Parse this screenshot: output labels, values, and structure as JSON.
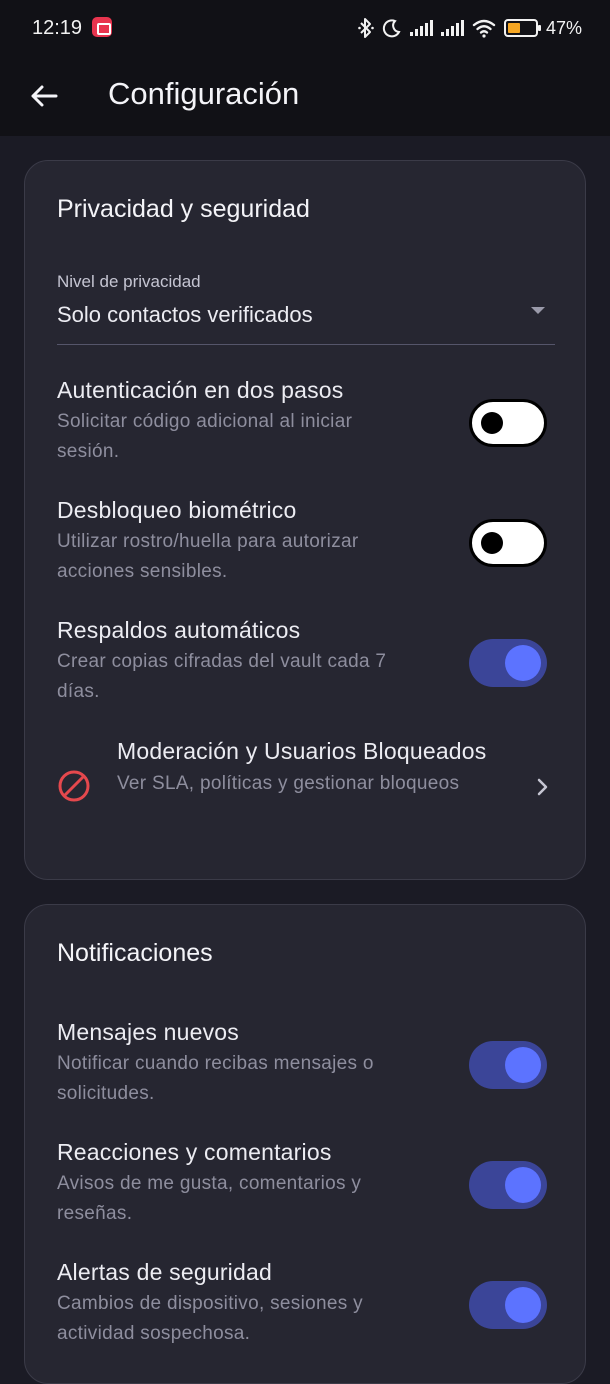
{
  "status_bar": {
    "time": "12:19",
    "battery_text": "47%",
    "battery_level": 0.47,
    "icons": [
      "bluetooth-icon",
      "moon-icon",
      "signal-icon",
      "signal-icon",
      "wifi-icon",
      "battery-icon"
    ]
  },
  "header": {
    "title": "Configuración",
    "back_icon": "arrow-left-icon"
  },
  "privacy_section": {
    "title": "Privacidad y seguridad",
    "privacy_level": {
      "label": "Nivel de privacidad",
      "value": "Solo contactos verificados"
    },
    "settings": [
      {
        "title": "Autenticación en dos pasos",
        "description": "Solicitar código adicional al iniciar sesión.",
        "enabled": false
      },
      {
        "title": "Desbloqueo biométrico",
        "description": "Utilizar rostro/huella para autorizar acciones sensibles.",
        "enabled": false
      },
      {
        "title": "Respaldos automáticos",
        "description": "Crear copias cifradas del vault cada 7 días.",
        "enabled": true
      }
    ],
    "moderation": {
      "title": "Moderación y Usuarios Bloqueados",
      "description": "Ver SLA, políticas y gestionar bloqueos",
      "icon": "block-icon"
    }
  },
  "notifications_section": {
    "title": "Notificaciones",
    "settings": [
      {
        "title": "Mensajes nuevos",
        "description": "Notificar cuando recibas mensajes o solicitudes.",
        "enabled": true
      },
      {
        "title": "Reacciones y comentarios",
        "description": "Avisos de me gusta, comentarios y reseñas.",
        "enabled": true
      },
      {
        "title": "Alertas de seguridad",
        "description": "Cambios de dispositivo, sesiones y actividad sospechosa.",
        "enabled": true
      }
    ]
  },
  "colors": {
    "background": "#1b1b25",
    "card": "#262631",
    "toggle_on_track": "#3b4598",
    "toggle_on_knob": "#5c73ff",
    "block_icon": "#e5484d"
  }
}
